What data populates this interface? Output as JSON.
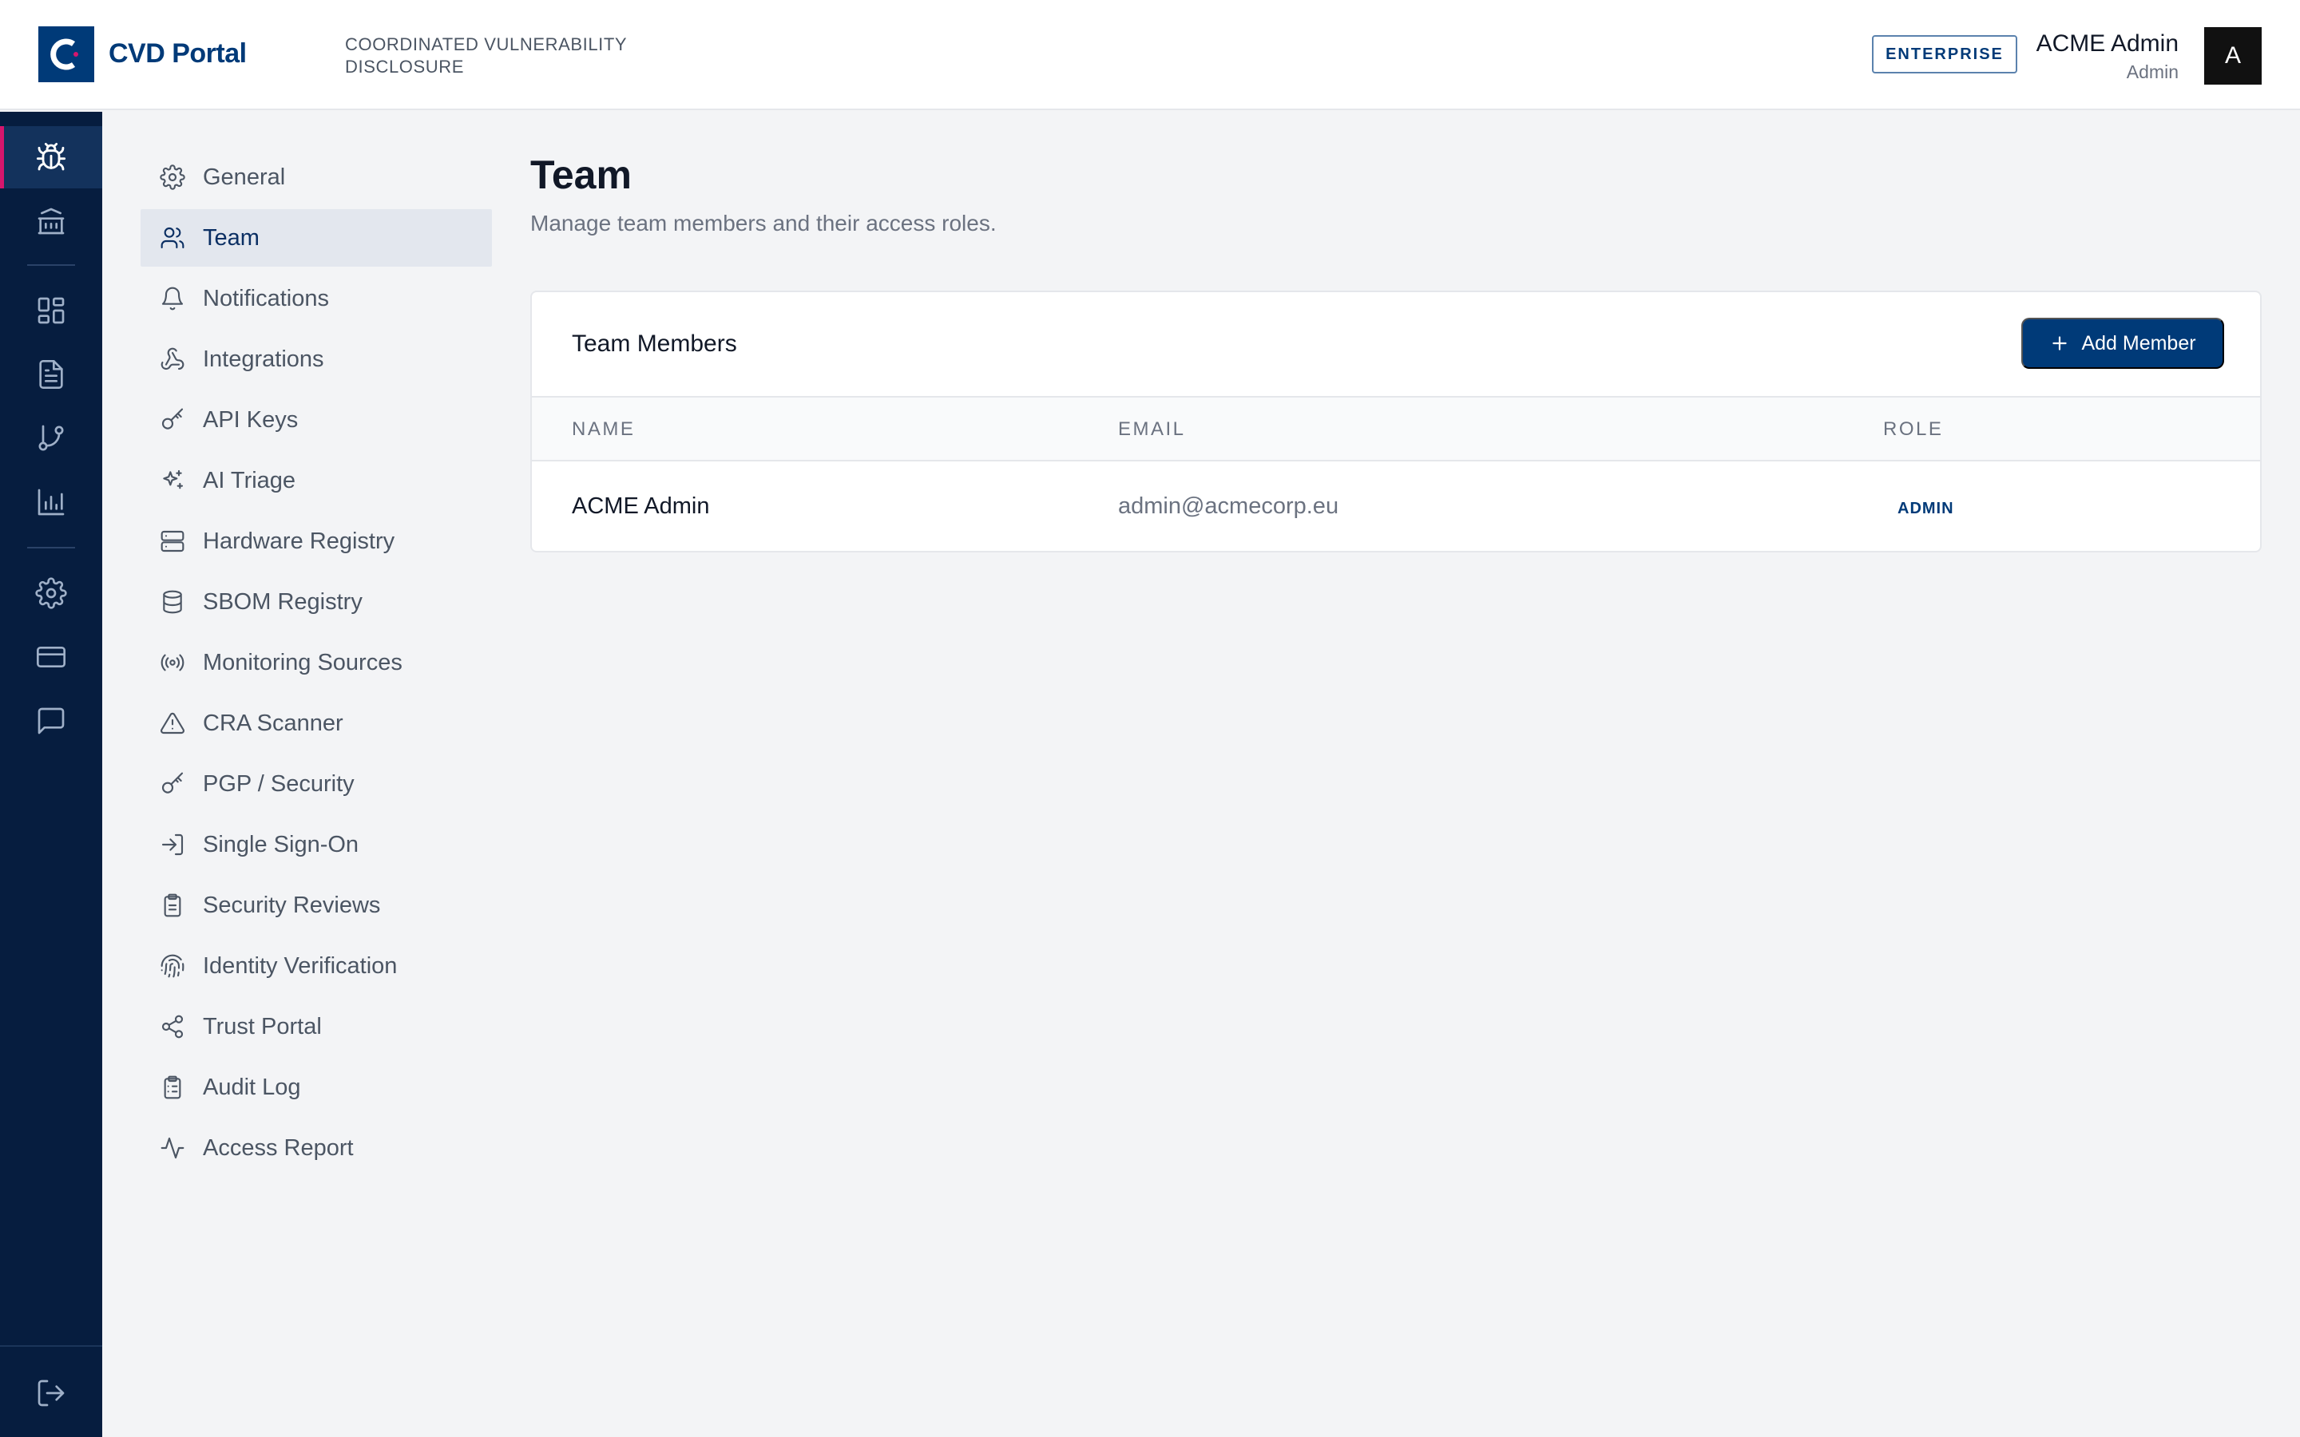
{
  "header": {
    "brand": "CVD Portal",
    "tagline": "COORDINATED VULNERABILITY DISCLOSURE",
    "plan_badge": "ENTERPRISE",
    "user_name": "ACME Admin",
    "user_role": "Admin",
    "avatar_initial": "A"
  },
  "rail": {
    "items": [
      {
        "icon": "bug-icon",
        "active": true
      },
      {
        "icon": "bank-icon",
        "active": false
      },
      {
        "icon": "dashboard-icon",
        "active": false
      },
      {
        "icon": "document-icon",
        "active": false
      },
      {
        "icon": "git-branch-icon",
        "active": false
      },
      {
        "icon": "bar-chart-icon",
        "active": false
      },
      {
        "icon": "gear-icon",
        "active": false
      },
      {
        "icon": "credit-card-icon",
        "active": false
      },
      {
        "icon": "message-icon",
        "active": false
      },
      {
        "icon": "logout-icon",
        "active": false
      }
    ]
  },
  "settings_nav": {
    "items": [
      {
        "label": "General",
        "icon": "gear-icon"
      },
      {
        "label": "Team",
        "icon": "users-icon",
        "active": true
      },
      {
        "label": "Notifications",
        "icon": "bell-icon"
      },
      {
        "label": "Integrations",
        "icon": "webhook-icon"
      },
      {
        "label": "API Keys",
        "icon": "key-icon"
      },
      {
        "label": "AI Triage",
        "icon": "sparkles-icon"
      },
      {
        "label": "Hardware Registry",
        "icon": "server-icon"
      },
      {
        "label": "SBOM Registry",
        "icon": "database-icon"
      },
      {
        "label": "Monitoring Sources",
        "icon": "radio-icon"
      },
      {
        "label": "CRA Scanner",
        "icon": "warning-triangle-icon"
      },
      {
        "label": "PGP / Security",
        "icon": "key-icon"
      },
      {
        "label": "Single Sign-On",
        "icon": "login-icon"
      },
      {
        "label": "Security Reviews",
        "icon": "clipboard-icon"
      },
      {
        "label": "Identity Verification",
        "icon": "fingerprint-icon"
      },
      {
        "label": "Trust Portal",
        "icon": "share-icon"
      },
      {
        "label": "Audit Log",
        "icon": "clipboard-list-icon"
      },
      {
        "label": "Access Report",
        "icon": "activity-icon"
      }
    ]
  },
  "main": {
    "title": "Team",
    "subtitle": "Manage team members and their access roles.",
    "card": {
      "title": "Team Members",
      "add_button": "Add Member",
      "columns": [
        "NAME",
        "EMAIL",
        "ROLE"
      ],
      "rows": [
        {
          "name": "ACME Admin",
          "email": "admin@acmecorp.eu",
          "role": "ADMIN"
        }
      ]
    }
  },
  "colors": {
    "brand": "#003a78",
    "rail_bg": "#061d3f",
    "rail_active_indicator": "#d6166d",
    "page_bg": "#f3f4f6"
  }
}
